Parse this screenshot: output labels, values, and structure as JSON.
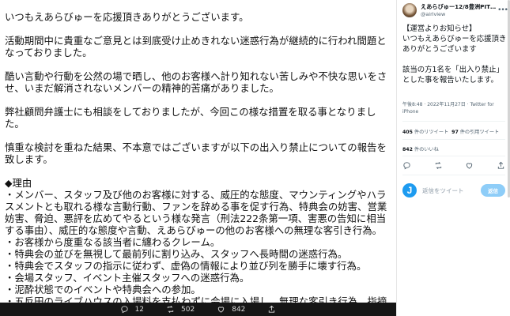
{
  "image": {
    "paragraphs": [
      "いつもえあらびゅーを応援頂きありがとうございます。",
      "活動期間中に貴重なご意見とは到底受け止めきれない迷惑行為が継続的に行われ間題となっておりました。",
      "酷い言動や行動を公然の場で晒し、他のお客様へ計り知れない苦しみや不快な思いをさせ、いまだ解消されないメンバーの精神的苦痛がありました。",
      "弊社顧問弁護士にも相談をしておりましたが、今回この様な措置を取る事となりました。",
      "慎重な検討を重ねた結果、不本意ではございますが以下の出入り禁止についての報告を致します。"
    ],
    "reasons_heading": "◆理由",
    "reasons": [
      "・メンバー、スタッフ及び他のお客様に対する、威圧的な態度、マウンティングやハラスメントとも取れる様な言動行動、ファンを辞める事を促す行為、特典会の妨害、営業妨害、脅迫、悪評を広めてやるという様な発言（刑法222条第一項、害悪の告知に相当する事由）、威圧的な態度や言動、えあらびゅーの他のお客様への無理な客引き行為。",
      "・お客様から度重なる該当者に纏わるクレーム。",
      "・特典会の並びを無視して最前列に割り込み、スタッフへ長時間の迷惑行為。",
      "・特典会でスタッフの指示に従わず、虚偽の情報により並び列を勝手に壊す行為。",
      "・会場スタッフ、イベント主催スタッフへの迷惑行為。",
      "・泥酔状態でのイベントや特典会への参加。",
      "・五反田のライブハウスの入場料を支払わずに会場に入場し、無理な客引き行為、指摘を行った際に威圧的な態度での脅迫。"
    ]
  },
  "actions": {
    "reply_count": "12",
    "retweet_count": "502",
    "like_count": "842"
  },
  "tweet": {
    "author_name": "えあらびゅー12/8豊洲PIT…",
    "author_handle": "@airlview",
    "text": "【運営よりお知らせ】\nいつもえあらびゅーを応援頂きありがとうございます\n\n該当の方1名を「出入り禁止」とした事を報告いたします。",
    "meta": "午後8:48 · 2022年11月27日 · Twitter for iPhone",
    "retweets_value": "405",
    "retweets_label": " 件のリツイート",
    "quotes_value": "97",
    "quotes_label": " 件の引用ツイート",
    "likes_value": "842",
    "likes_label": " 件のいいね"
  },
  "reply": {
    "avatar_letter": "J",
    "placeholder": "返信をツイート",
    "button_label": "返信"
  }
}
